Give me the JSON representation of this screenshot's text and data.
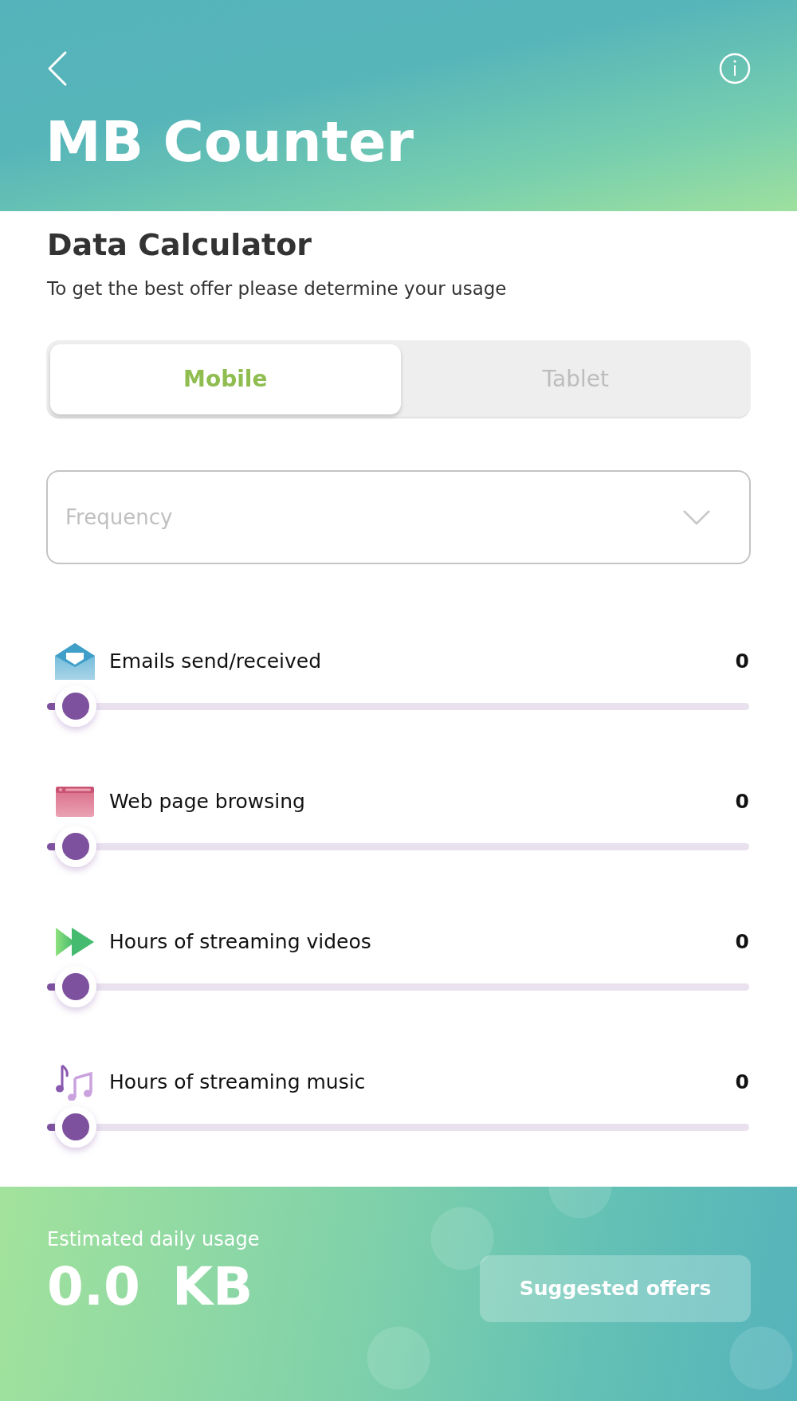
{
  "header": {
    "title": "MB Counter"
  },
  "calculator": {
    "heading": "Data Calculator",
    "subtitle": "To get the best offer please determine your usage"
  },
  "device_tabs": [
    {
      "label": "Mobile",
      "selected": true
    },
    {
      "label": "Tablet",
      "selected": false
    }
  ],
  "frequency": {
    "placeholder": "Frequency"
  },
  "usage_items": [
    {
      "kind": "mail",
      "label": "Emails send/received",
      "value": "0",
      "level": 0
    },
    {
      "kind": "web",
      "label": "Web page browsing",
      "value": "0",
      "level": 0
    },
    {
      "kind": "video",
      "label": "Hours of streaming videos",
      "value": "0",
      "level": 0
    },
    {
      "kind": "music",
      "label": "Hours of streaming music",
      "value": "0",
      "level": 0
    }
  ],
  "footer": {
    "caption": "Estimated daily usage",
    "amount": "0.0",
    "unit": "KB",
    "button": "Suggested offers"
  }
}
